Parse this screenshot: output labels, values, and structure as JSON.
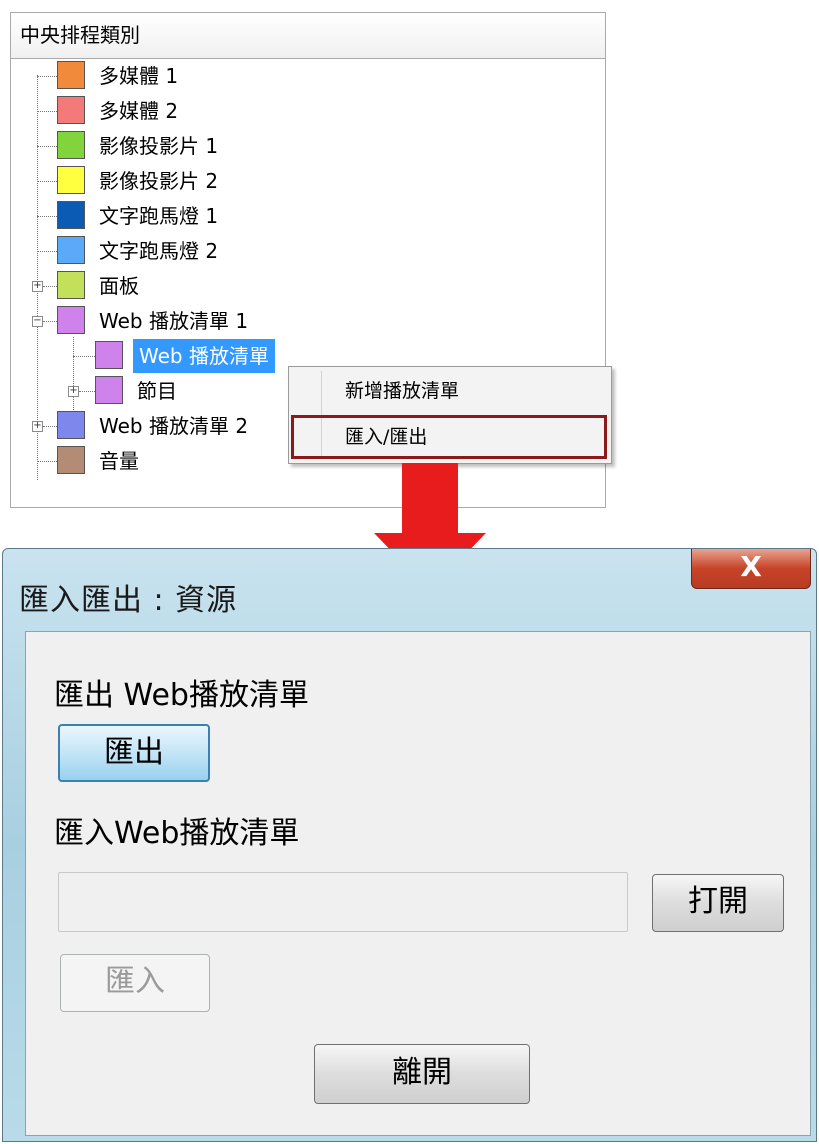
{
  "tree": {
    "header": "中央排程類別",
    "nodes": [
      {
        "label": "多媒體 1",
        "color": "#f28a3c"
      },
      {
        "label": "多媒體 2",
        "color": "#f47a7a"
      },
      {
        "label": "影像投影片 1",
        "color": "#82d43c"
      },
      {
        "label": "影像投影片 2",
        "color": "#ffff40"
      },
      {
        "label": "文字跑馬燈 1",
        "color": "#0b5ab3"
      },
      {
        "label": "文字跑馬燈 2",
        "color": "#5aaaf7"
      },
      {
        "label": "面板",
        "color": "#c3e05a",
        "expander": "+"
      },
      {
        "label": "Web 播放清單 1",
        "color": "#cf82ec",
        "expander": "−"
      },
      {
        "label": "Web 播放清單",
        "color": "#cf82ec",
        "selected": true
      },
      {
        "label": "節目",
        "color": "#cf82ec",
        "expander": "+"
      },
      {
        "label": "Web 播放清單 2",
        "color": "#7d87ec",
        "expander": "+"
      },
      {
        "label": "音量",
        "color": "#b48c76"
      }
    ]
  },
  "context_menu": {
    "items": [
      "新增播放清單",
      "匯入/匯出"
    ],
    "highlighted_index": 1
  },
  "dialog": {
    "title": "匯入匯出 : 資源",
    "close_label": "X",
    "export_section_label": "匯出 Web播放清單",
    "export_button": "匯出",
    "import_section_label": "匯入Web播放清單",
    "path_value": "",
    "open_button": "打開",
    "import_button": "匯入",
    "leave_button": "離開"
  },
  "colors": {
    "selection": "#3399ff",
    "highlight_border": "#8b1a1a",
    "arrow": "#e81c1c"
  }
}
